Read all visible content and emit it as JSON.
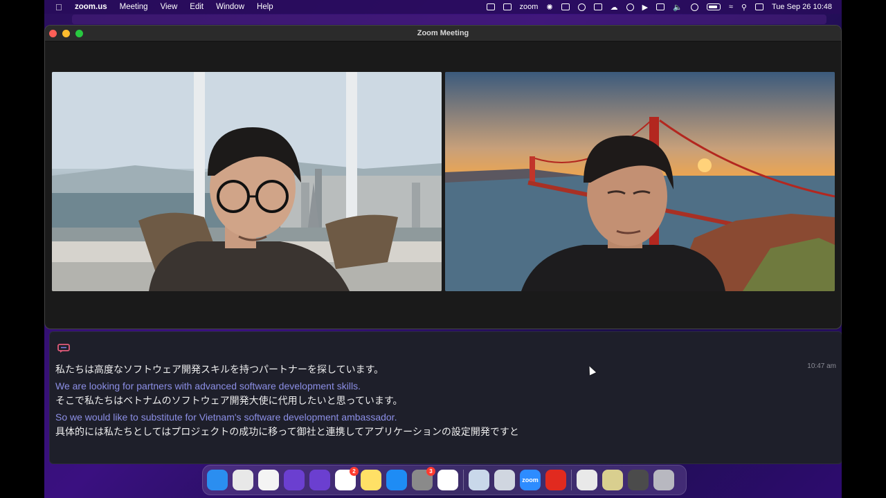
{
  "menubar": {
    "app_name": "zoom.us",
    "items": [
      "Meeting",
      "View",
      "Edit",
      "Window",
      "Help"
    ],
    "zoom_label": "zoom",
    "clock": "Tue Sep 26  10:48"
  },
  "window": {
    "title": "Zoom Meeting"
  },
  "transcript": {
    "timestamp": "10:47 am",
    "lines": [
      {
        "lang": "ja",
        "text": "私たちは高度なソフトウェア開発スキルを持つパートナーを探しています。"
      },
      {
        "lang": "en",
        "text": "We are looking for partners with advanced software development skills."
      },
      {
        "lang": "ja",
        "text": "そこで私たちはベトナムのソフトウェア開発大使に代用したいと思っています。"
      },
      {
        "lang": "en",
        "text": "So we would like to substitute for Vietnam's software development ambassador."
      },
      {
        "lang": "ja",
        "text": "具体的には私たちとしてはプロジェクトの成功に移って御社と連携してアプリケーションの設定開発ですと"
      }
    ]
  },
  "dock": {
    "items": [
      {
        "name": "finder-icon",
        "color": "#2b8ef0"
      },
      {
        "name": "launchpad-icon",
        "color": "#e8e8e8"
      },
      {
        "name": "chrome-icon",
        "color": "#f4f4f4"
      },
      {
        "name": "translator-app-icon",
        "color": "#6b3fd0"
      },
      {
        "name": "translator-app-2-icon",
        "color": "#6b3fd0"
      },
      {
        "name": "slack-icon",
        "color": "#ffffff",
        "badge": "2"
      },
      {
        "name": "notes-icon",
        "color": "#ffe066"
      },
      {
        "name": "app-store-icon",
        "color": "#1e8cf5"
      },
      {
        "name": "system-settings-icon",
        "color": "#8a8a8a",
        "badge": "3"
      },
      {
        "name": "mail-app-icon",
        "color": "#ffffff"
      },
      {
        "name": "preview-icon",
        "color": "#c9d8ea"
      },
      {
        "name": "quicktime-icon",
        "color": "#d0d6e0"
      },
      {
        "name": "zoom-icon",
        "color": "#2d8cff",
        "label": "zoom"
      },
      {
        "name": "acrobat-icon",
        "color": "#e12a1f"
      },
      {
        "name": "documents-stack-icon",
        "color": "#e9e9e9"
      },
      {
        "name": "folder-stack-icon",
        "color": "#d9cf8f"
      },
      {
        "name": "screenshots-stack-icon",
        "color": "#4b4b4b"
      },
      {
        "name": "trash-icon",
        "color": "#b8b8c0"
      }
    ]
  }
}
